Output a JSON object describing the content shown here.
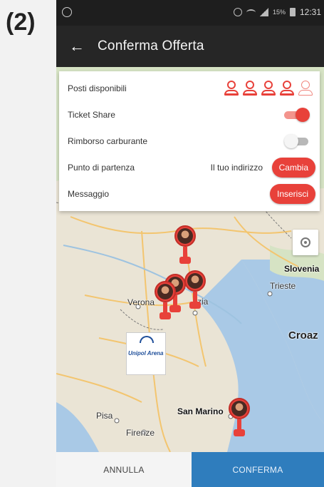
{
  "figure_label": "(2)",
  "status_bar": {
    "battery_pct": "15%",
    "time": "12:31"
  },
  "app_bar": {
    "back_icon": "arrow-left-icon",
    "title": "Conferma Offerta"
  },
  "form": {
    "seats": {
      "label": "Posti disponibili",
      "total": 5,
      "selected": 4,
      "icon": "person-icon"
    },
    "ticket_share": {
      "label": "Ticket Share",
      "enabled": true
    },
    "fuel_refund": {
      "label": "Rimborso carburante",
      "enabled": false
    },
    "departure": {
      "label": "Punto di partenza",
      "value": "Il tuo indirizzo",
      "button_label": "Cambia"
    },
    "message": {
      "label": "Messaggio",
      "button_label": "Inserisci"
    }
  },
  "map": {
    "labels": [
      "Slovenia",
      "Trieste",
      "Verona",
      "zia",
      "Croaz",
      "Pisa",
      "Firenze",
      "San Marino"
    ],
    "logo_text": "Unipol Arena",
    "locate_icon": "gps-crosshair-icon"
  },
  "bottom_bar": {
    "cancel_label": "ANNULLA",
    "confirm_label": "CONFERMA"
  },
  "colors": {
    "accent_red": "#e8413a",
    "confirm_blue": "#2f7dbd",
    "app_bar": "#262626"
  }
}
